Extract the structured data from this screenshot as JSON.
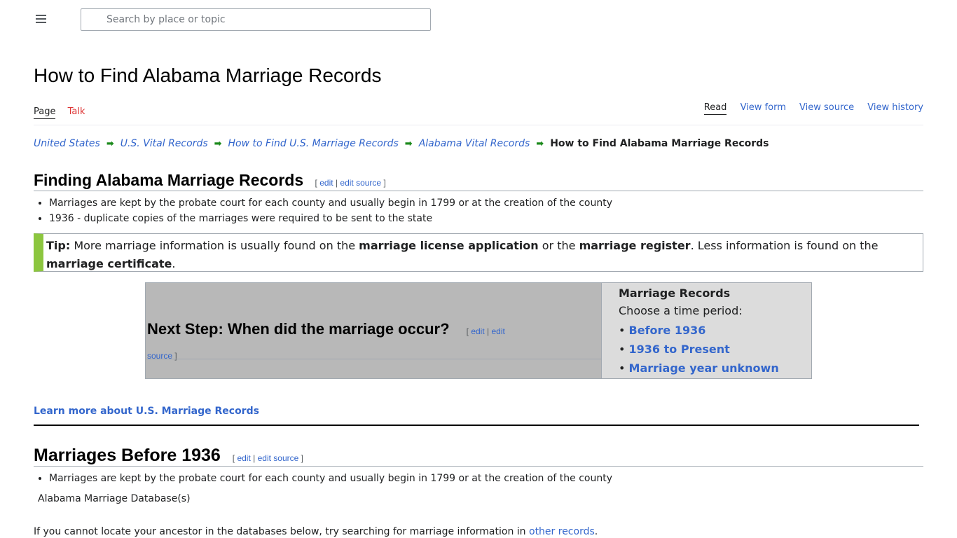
{
  "search": {
    "placeholder": "Search by place or topic"
  },
  "page_title": "How to Find Alabama Marriage Records",
  "tabs_left": [
    "Page",
    "Talk"
  ],
  "tabs_right": [
    "Read",
    "View form",
    "View source",
    "View history"
  ],
  "breadcrumb": {
    "items": [
      "United States",
      "U.S. Vital Records",
      "How to Find U.S. Marriage Records",
      "Alabama Vital Records"
    ],
    "current": "How to Find Alabama Marriage Records"
  },
  "edit": {
    "open": "[",
    "edit": "edit",
    "sep": "|",
    "edit_source": "edit source",
    "close": "]"
  },
  "section1": {
    "heading": "Finding Alabama Marriage Records",
    "bullets": [
      "Marriages are kept by the probate court for each county and usually begin in 1799 or at the creation of the county",
      "1936 - duplicate copies of the marriages were required to be sent to the state"
    ]
  },
  "tip": {
    "label": "Tip:",
    "t1": " More marriage information is usually found on the ",
    "b1": "marriage license application",
    "t2": " or the ",
    "b2": "marriage register",
    "t3": ". Less information is found on the ",
    "b3": "marriage certificate",
    "t4": "."
  },
  "next_step": {
    "heading": "Next Step: When did the marriage occur?",
    "edit_a": "edit",
    "edit_b": "edit",
    "edit_c": "source",
    "box_title": "Marriage Records",
    "box_sub": "Choose a time period:",
    "options": [
      "Before 1936",
      "1936 to Present",
      "Marriage year unknown"
    ]
  },
  "learn_more": "Learn more about U.S. Marriage Records",
  "section2": {
    "heading": "Marriages Before 1936",
    "bullets": [
      "Marriages are kept by the probate court for each county and usually begin in 1799 or at the creation of the county"
    ],
    "db_label": "Alabama Marriage Database(s)",
    "para_text": "If you cannot locate your ancestor in the databases below, try searching for marriage information in ",
    "para_link": "other records",
    "para_end": "."
  },
  "colors": {
    "link": "#3366cc",
    "tip_bar": "#8cc63f",
    "talk": "#dd3333",
    "arrow": "#1c8a1c"
  }
}
